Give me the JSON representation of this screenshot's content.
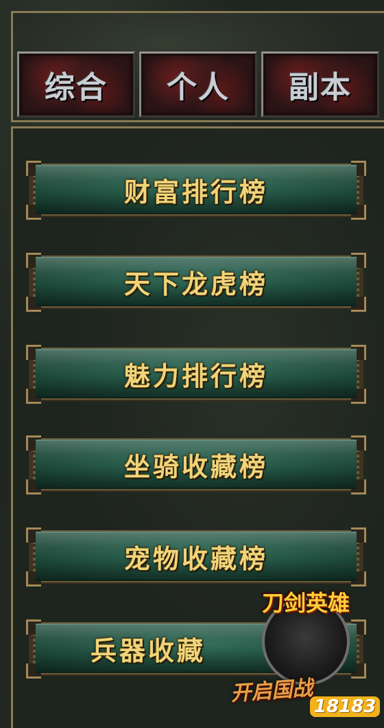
{
  "tabs": [
    {
      "label": "综合"
    },
    {
      "label": "个人"
    },
    {
      "label": "副本"
    }
  ],
  "rankings": [
    {
      "label": "财富排行榜"
    },
    {
      "label": "天下龙虎榜"
    },
    {
      "label": "魅力排行榜"
    },
    {
      "label": "坐骑收藏榜"
    },
    {
      "label": "宠物收藏榜"
    },
    {
      "label": "兵器收藏"
    }
  ],
  "watermark": {
    "game_logo": "刀剑英雄",
    "tagline": "开启国战",
    "site": "18183"
  },
  "colors": {
    "tab_text": "#c9ced4",
    "rank_text": "#f0d47a",
    "frame_gold": "#8a7a55",
    "button_green": "#21503f"
  }
}
